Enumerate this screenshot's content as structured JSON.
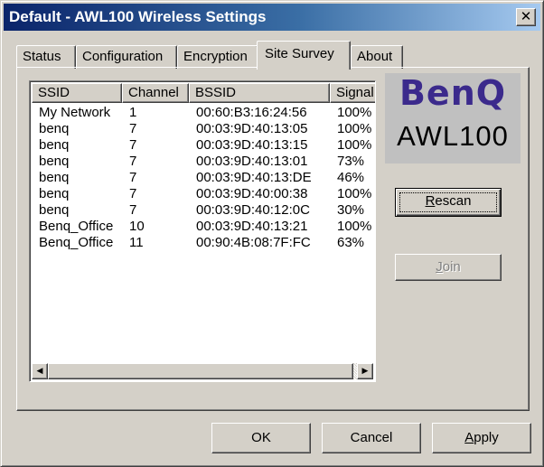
{
  "window": {
    "title": "Default - AWL100 Wireless Settings",
    "close_glyph": "✕"
  },
  "tabs": [
    {
      "label": "Status",
      "active": false
    },
    {
      "label": "Configuration",
      "active": false
    },
    {
      "label": "Encryption",
      "active": false
    },
    {
      "label": "Site Survey",
      "active": true
    },
    {
      "label": "About",
      "active": false
    }
  ],
  "list": {
    "columns": [
      "SSID",
      "Channel",
      "BSSID",
      "Signal"
    ],
    "rows": [
      {
        "ssid": "My Network",
        "channel": "1",
        "bssid": "00:60:B3:16:24:56",
        "signal": "100%"
      },
      {
        "ssid": "benq",
        "channel": "7",
        "bssid": "00:03:9D:40:13:05",
        "signal": "100%"
      },
      {
        "ssid": "benq",
        "channel": "7",
        "bssid": "00:03:9D:40:13:15",
        "signal": "100%"
      },
      {
        "ssid": "benq",
        "channel": "7",
        "bssid": "00:03:9D:40:13:01",
        "signal": "73%"
      },
      {
        "ssid": "benq",
        "channel": "7",
        "bssid": "00:03:9D:40:13:DE",
        "signal": "46%"
      },
      {
        "ssid": "benq",
        "channel": "7",
        "bssid": "00:03:9D:40:00:38",
        "signal": "100%"
      },
      {
        "ssid": "benq",
        "channel": "7",
        "bssid": "00:03:9D:40:12:0C",
        "signal": "30%"
      },
      {
        "ssid": "Benq_Office",
        "channel": "10",
        "bssid": "00:03:9D:40:13:21",
        "signal": "100%"
      },
      {
        "ssid": "Benq_Office",
        "channel": "11",
        "bssid": "00:90:4B:08:7F:FC",
        "signal": "63%"
      }
    ],
    "scroll_left_glyph": "◀",
    "scroll_right_glyph": "▶"
  },
  "logo": {
    "brand": "BenQ",
    "model": "AWL100",
    "brand_color": "#3b2a8c"
  },
  "buttons": {
    "rescan": {
      "pre": "",
      "accel": "R",
      "post": "escan",
      "enabled": true
    },
    "join": {
      "pre": "",
      "accel": "J",
      "post": "oin",
      "enabled": false
    },
    "ok": {
      "label": "OK"
    },
    "cancel": {
      "label": "Cancel"
    },
    "apply": {
      "pre": "",
      "accel": "A",
      "post": "pply"
    }
  }
}
